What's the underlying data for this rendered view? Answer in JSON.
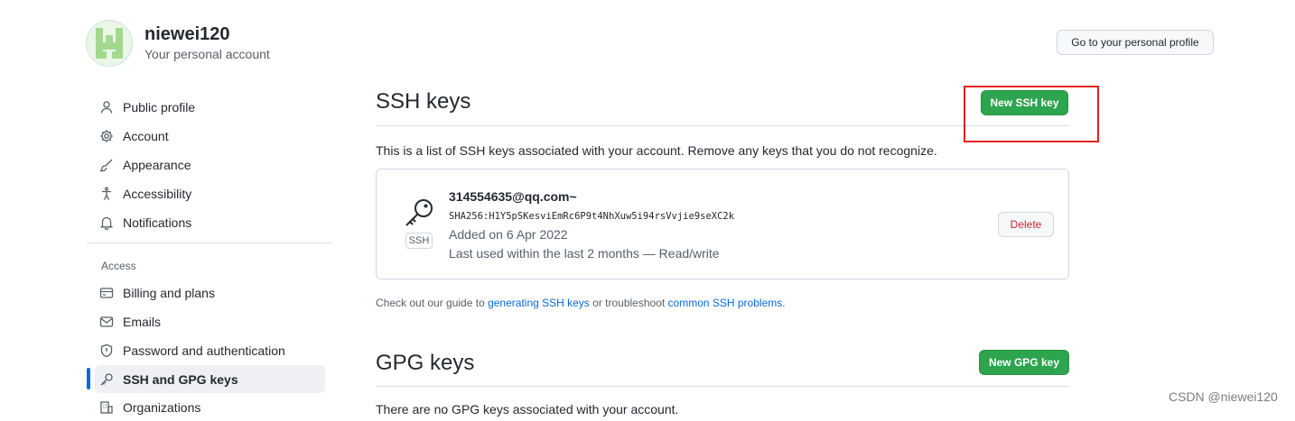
{
  "header": {
    "username": "niewei120",
    "subtitle": "Your personal account",
    "profile_button": "Go to your personal profile"
  },
  "sidebar": {
    "items": [
      {
        "label": "Public profile",
        "icon": "person-icon"
      },
      {
        "label": "Account",
        "icon": "gear-icon"
      },
      {
        "label": "Appearance",
        "icon": "paintbrush-icon"
      },
      {
        "label": "Accessibility",
        "icon": "accessibility-icon"
      },
      {
        "label": "Notifications",
        "icon": "bell-icon"
      }
    ],
    "access_label": "Access",
    "access_items": [
      {
        "label": "Billing and plans",
        "icon": "credit-card-icon"
      },
      {
        "label": "Emails",
        "icon": "mail-icon"
      },
      {
        "label": "Password and authentication",
        "icon": "shield-lock-icon"
      },
      {
        "label": "SSH and GPG keys",
        "icon": "key-icon",
        "active": true
      },
      {
        "label": "Organizations",
        "icon": "organization-icon"
      }
    ]
  },
  "ssh": {
    "title": "SSH keys",
    "new_button": "New SSH key",
    "description": "This is a list of SSH keys associated with your account. Remove any keys that you do not recognize.",
    "key": {
      "title": "314554635@qq.com~",
      "fingerprint": "SHA256:H1Y5pSKesviEmRc6P9t4NhXuw5i94rsVvjie9seXC2k",
      "added": "Added on 6 Apr 2022",
      "last_used": "Last used within the last 2 months — Read/write",
      "badge": "SSH",
      "delete_button": "Delete"
    },
    "guide": {
      "prefix": "Check out our guide to ",
      "link1": "generating SSH keys",
      "middle": " or troubleshoot ",
      "link2": "common SSH problems",
      "suffix": "."
    }
  },
  "gpg": {
    "title": "GPG keys",
    "new_button": "New GPG key",
    "empty_text": "There are no GPG keys associated with your account."
  },
  "watermark": "CSDN @niewei120",
  "colors": {
    "accent_blue": "#0969da",
    "green_button": "#2da44e",
    "danger_red": "#cf222e",
    "highlight_box": "#e2231a"
  }
}
